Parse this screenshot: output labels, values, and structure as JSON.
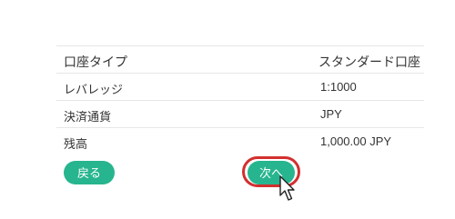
{
  "table": {
    "rows": [
      {
        "label": "口座タイプ",
        "value": "スタンダード口座"
      },
      {
        "label": "レバレッジ",
        "value": "1:1000"
      },
      {
        "label": "決済通貨",
        "value": "JPY"
      },
      {
        "label": "残高",
        "value": "1,000.00 JPY"
      }
    ]
  },
  "buttons": {
    "back_label": "戻る",
    "next_label": "次へ"
  },
  "colors": {
    "button_green": "#27b58f",
    "highlight_red": "#d32f2f"
  },
  "icons": {
    "cursor": "mouse-pointer-icon"
  }
}
